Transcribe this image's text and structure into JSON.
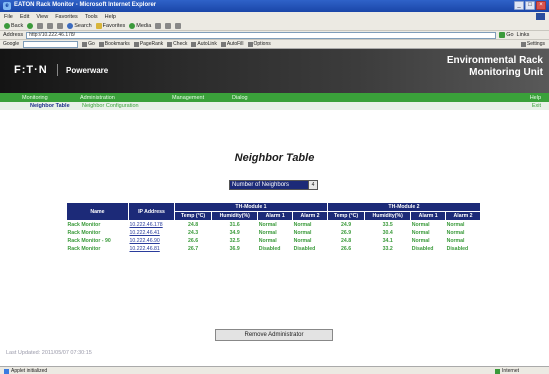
{
  "window": {
    "title": "EATON Rack Monitor - Microsoft Internet Explorer",
    "minimize": "_",
    "maximize": "□",
    "close": "×"
  },
  "menu": [
    "File",
    "Edit",
    "View",
    "Favorites",
    "Tools",
    "Help"
  ],
  "toolbar": {
    "back": "Back",
    "forward": "",
    "search": "Search",
    "favorites": "Favorites",
    "media": "Media"
  },
  "address": {
    "label": "Address",
    "value": "http://10.222.46.178/",
    "go": "Go",
    "links": "Links"
  },
  "linksbar": {
    "google_label": "Google",
    "items": [
      "Go",
      "Bookmarks",
      "PageRank",
      "Check",
      "AutoLink",
      "AutoFill",
      "Options"
    ],
    "settings": "Settings"
  },
  "header": {
    "logo": "F:T·N",
    "brand": "Powerware",
    "product_line1": "Environmental Rack",
    "product_line2": "Monitoring Unit"
  },
  "nav": {
    "items": [
      "Monitoring",
      "Administration",
      "Management",
      "Dialog"
    ],
    "help": "Help"
  },
  "subnav": {
    "active": "Neighbor Table",
    "link": "Neighbor Configuration",
    "exit": "Exit"
  },
  "page": {
    "title": "Neighbor Table",
    "selector_label": "Number of Neighbors",
    "selector_value": "4",
    "remove_button": "Remove Administrator",
    "last_updated": "Last Updated: 2011/05/07 07:30:15"
  },
  "table": {
    "headers": {
      "name": "Name",
      "ip": "IP Address",
      "module1": "TH-Module 1",
      "module2": "TH-Module 2",
      "sub": [
        "Temp (°C)",
        "Humidity(%)",
        "Alarm 1",
        "Alarm 2",
        "Temp (°C)",
        "Humidity(%)",
        "Alarm 1",
        "Alarm 2"
      ]
    },
    "rows": [
      {
        "name": "Rack Monitor",
        "ip": "10.222.46.178",
        "t1": "24.8",
        "h1": "31.6",
        "a11": "Normal",
        "a12": "Normal",
        "t2": "24.9",
        "h2": "33.5",
        "a21": "Normal",
        "a22": "Normal"
      },
      {
        "name": "Rack Monitor",
        "ip": "10.222.46.41",
        "t1": "24.3",
        "h1": "34.9",
        "a11": "Normal",
        "a12": "Normal",
        "t2": "26.9",
        "h2": "30.4",
        "a21": "Normal",
        "a22": "Normal"
      },
      {
        "name": "Rack Monitor - 90",
        "ip": "10.222.46.90",
        "t1": "26.6",
        "h1": "32.5",
        "a11": "Normal",
        "a12": "Normal",
        "t2": "24.8",
        "h2": "34.1",
        "a21": "Normal",
        "a22": "Normal"
      },
      {
        "name": "Rack Monitor",
        "ip": "10.222.46.81",
        "t1": "26.7",
        "h1": "36.9",
        "a11": "Disabled",
        "a12": "Disabled",
        "t2": "26.6",
        "h2": "33.2",
        "a21": "Disabled",
        "a22": "Disabled"
      }
    ]
  },
  "status": {
    "left": "Applet initialized",
    "right": "Internet"
  }
}
